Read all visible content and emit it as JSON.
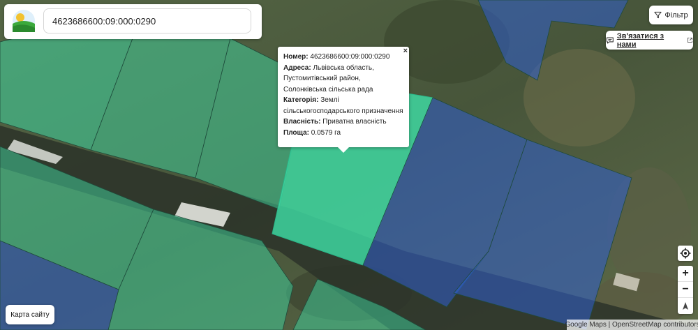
{
  "search": {
    "value": "4623686600:09:000:0290"
  },
  "filter": {
    "label": "Фільтр",
    "icon": "filter-icon"
  },
  "contact": {
    "label": "Зв'язатися з нами",
    "icon": "chat-icon",
    "external_icon": "external-link-icon"
  },
  "popup": {
    "close_label": "×",
    "fields": [
      {
        "label": "Номер:",
        "value": "4623686600:09:000:0290"
      },
      {
        "label": "Адреса:",
        "value": "Львівська область, Пустомитівський район, Солонківська сільська рада"
      },
      {
        "label": "Категорія:",
        "value": "Землі сільськогосподарського призначення"
      },
      {
        "label": "Власність:",
        "value": "Приватна власність"
      },
      {
        "label": "Площа:",
        "value": "0.0579 га"
      }
    ]
  },
  "controls": {
    "locate_icon": "crosshair-icon",
    "zoom_in": "+",
    "zoom_out": "−",
    "compass_icon": "north-arrow-icon"
  },
  "footer": {
    "sitemap_label": "Карта сайту",
    "attribution": "Google Maps | OpenStreetMap contributors"
  },
  "colors": {
    "parcel_green": "#3fd6a0",
    "parcel_blue": "#2f5fd0",
    "panel_bg": "#ffffff"
  }
}
